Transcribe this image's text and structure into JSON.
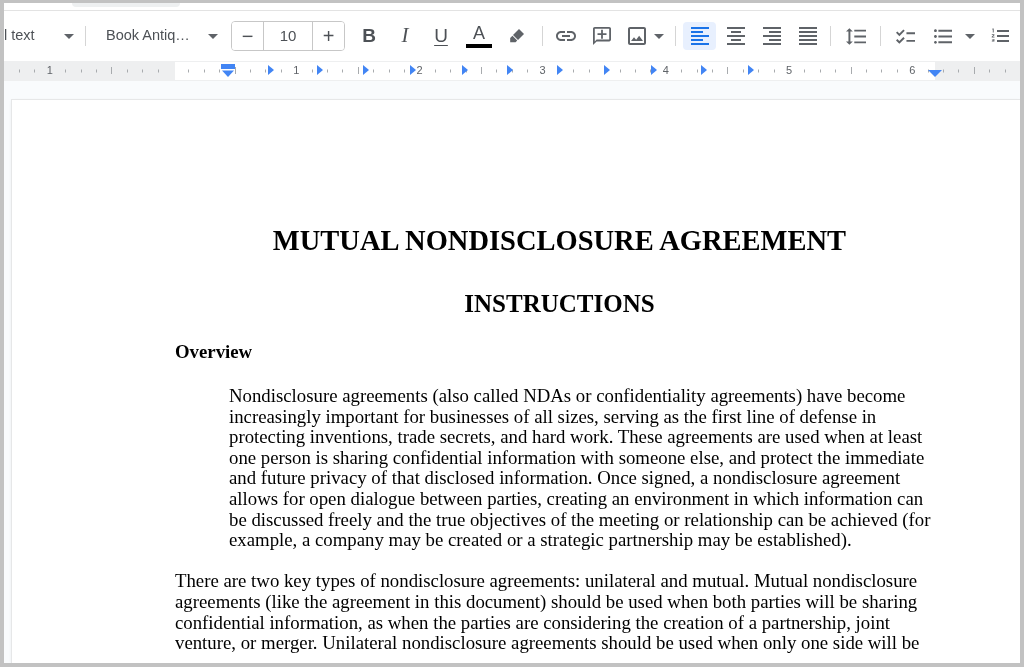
{
  "toolbar": {
    "paragraph_style": {
      "label": "l text"
    },
    "font": {
      "label": "Book Antiq…"
    },
    "font_size": {
      "decrease": "−",
      "value": "10",
      "increase": "+"
    },
    "text_format": [
      {
        "kind": "bold",
        "label": "B"
      },
      {
        "kind": "italic",
        "label": "I"
      },
      {
        "kind": "underline",
        "label": "U"
      },
      {
        "kind": "text_color",
        "label": "A",
        "color": "#000000"
      }
    ],
    "alignment": [
      {
        "selected": true
      },
      {
        "selected": false
      },
      {
        "selected": false
      },
      {
        "selected": false
      }
    ]
  },
  "ruler": {
    "numbers": [
      "1",
      "1",
      "2",
      "3",
      "4",
      "5",
      "6"
    ]
  },
  "document": {
    "title": "MUTUAL NONDISCLOSURE AGREEMENT",
    "subtitle": "INSTRUCTIONS",
    "heading": "Overview",
    "paragraphs": [
      {
        "kind": "indented",
        "lines": [
          "Nondisclosure agreements (also called NDAs or confidentiality agreements) have become",
          "increasingly important for businesses of all sizes, serving as the first line of defense in",
          "protecting inventions, trade secrets, and hard work. These agreements are used when at least",
          "one person is sharing confidential information with someone else, and protect the immediate",
          "and future privacy of that disclosed information. Once signed, a nondisclosure agreement",
          "allows for open dialogue between parties, creating an environment in which information can",
          "be discussed freely and the true objectives of the meeting or relationship can be achieved (for",
          "example, a company may be created or a strategic partnership may be established)."
        ]
      },
      {
        "kind": "body",
        "lines": [
          "There are two key types of nondisclosure agreements: unilateral and mutual. Mutual nondisclosure",
          "agreements (like the agreement in this document) should be used when both parties will be sharing",
          "confidential information, as when the parties are considering the creation of a partnership, joint",
          "venture, or merger. Unilateral nondisclosure agreements should be used when only one side will be"
        ]
      }
    ]
  }
}
